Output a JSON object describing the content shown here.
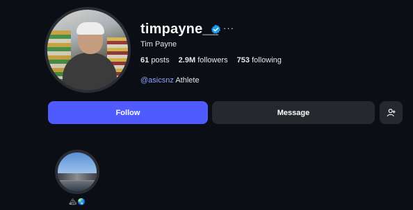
{
  "profile": {
    "username": "timpayne__",
    "full_name": "Tim Payne",
    "verified": true,
    "more_label": "···",
    "avatar_icon": "profile-photo"
  },
  "stats": {
    "posts_count": "61",
    "posts_label": "posts",
    "followers_count": "2.9M",
    "followers_label": "followers",
    "following_count": "753",
    "following_label": "following"
  },
  "bio": {
    "mention": "@asicsnz",
    "text": "Athlete"
  },
  "actions": {
    "follow_label": "Follow",
    "message_label": "Message",
    "add_user_icon": "person-add-icon"
  },
  "highlights": [
    {
      "label": "🏔🌏",
      "emoji_1": "🏔",
      "emoji_2": "🌏"
    }
  ],
  "colors": {
    "background": "#0b0e14",
    "follow_button": "#4f5bff",
    "secondary_button": "#26282d",
    "mention": "#8fa2ff",
    "verified_badge": "#1d9bf0"
  }
}
